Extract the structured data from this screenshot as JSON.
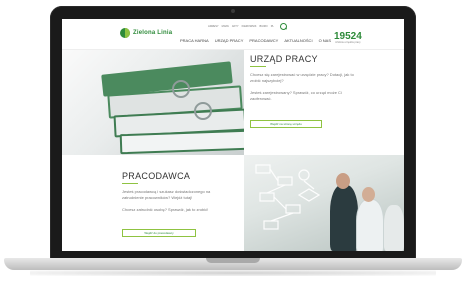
{
  "site": {
    "logo_text": "Zielona Linia",
    "utility": [
      "ADRESY",
      "MAPA",
      "AKTY",
      "KIEROWNIK",
      "BIURO",
      "PL"
    ],
    "nav": [
      "Praca Harna",
      "Urząd pracy",
      "Pracodawcy",
      "Aktualności",
      "O nas"
    ],
    "hotline_number": "19524",
    "hotline_sub": "infolinia urzędów pracy"
  },
  "sections": {
    "urzad": {
      "title": "URZĄD PRACY",
      "text1": "Chcesz się zarejestrować w urzędzie pracy? Dotacji, jak to zrobić najszybciej?",
      "text2": "Jesteś zarejestrowany? Sprawdź, co urząd może Ci zaoferować.",
      "button": "Wejdź na stronę urzędu"
    },
    "pracodawca": {
      "title": "PRACODAWCA",
      "text1": "Jesteś pracodawcą i szukasz doświadczonego na zatrudnienie pracowników? Wejdź tutaj!",
      "text2": "Chcesz zatrudnić osobę? Sprawdź, jak to zrobić!",
      "button": "Wejdź do pracodawcy"
    }
  },
  "colors": {
    "brand_dark": "#2e8b3a",
    "brand_light": "#8fc341",
    "laptop_bezel": "#1a1a1a"
  }
}
